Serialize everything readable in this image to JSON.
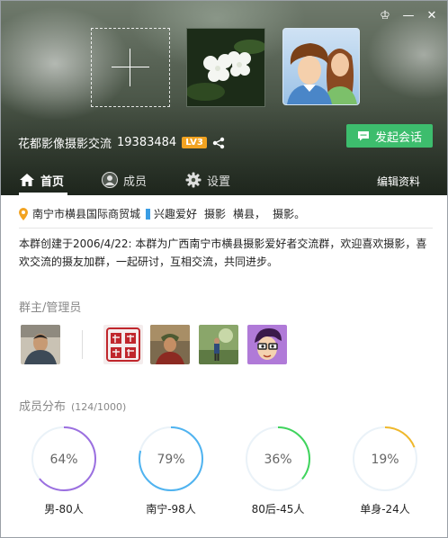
{
  "window": {
    "controls": [
      {
        "name": "skin-icon",
        "glyph": "♔"
      },
      {
        "name": "minimize-icon",
        "glyph": "—"
      },
      {
        "name": "close-icon",
        "glyph": "✕"
      }
    ]
  },
  "header": {
    "group_name": "花都影像摄影交流",
    "group_id": "19383484",
    "level_badge": "LV3",
    "chat_button_label": "发起会话",
    "add_photo_icon": "plus-icon",
    "colors": {
      "chat_button": "#3dbd6d",
      "level_badge": "#f2a321"
    }
  },
  "tabs": [
    {
      "label": "首页",
      "icon": "home-icon",
      "active": true
    },
    {
      "label": "成员",
      "icon": "member-icon",
      "active": false
    },
    {
      "label": "设置",
      "icon": "gear-icon",
      "active": false
    }
  ],
  "edit_profile_label": "编辑资料",
  "info": {
    "location": "南宁市横县国际商贸城",
    "interest_tag": "兴趣爱好",
    "tags": [
      "摄影",
      "横县，",
      "摄影。"
    ],
    "description": "本群创建于2006/4/22:  本群为广西南宁市横县摄影爱好者交流群，欢迎喜欢摄影，喜欢交流的摄友加群，一起研讨，互相交流，共同进步。",
    "colors": {
      "location_icon": "#f2a321",
      "interest_bar": "#3a9de4"
    }
  },
  "admins": {
    "title": "群主/管理员",
    "count": 5
  },
  "members": {
    "title": "成员分布",
    "count": "(124/1000)",
    "stats": [
      {
        "label": "男-80人",
        "value_text": "64%",
        "fraction": 0.64,
        "color": "#9b6fe0"
      },
      {
        "label": "南宁-98人",
        "value_text": "79%",
        "fraction": 0.79,
        "color": "#4fb3f0"
      },
      {
        "label": "80后-45人",
        "value_text": "36%",
        "fraction": 0.36,
        "color": "#3fd45c"
      },
      {
        "label": "单身-24人",
        "value_text": "19%",
        "fraction": 0.19,
        "color": "#f0b82a"
      }
    ]
  }
}
